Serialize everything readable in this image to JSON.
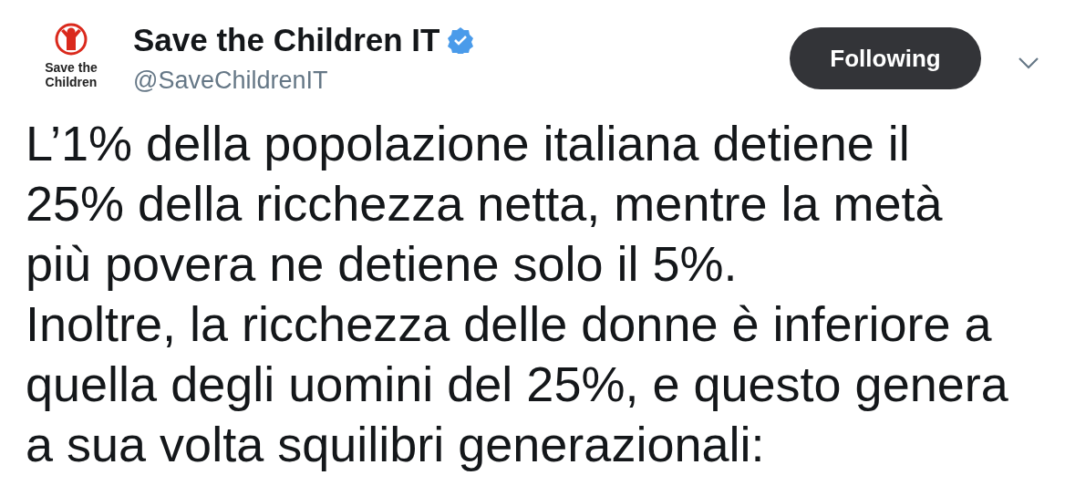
{
  "account": {
    "logo_lines": [
      "Save the",
      "Children"
    ],
    "name": "Save the Children IT",
    "verified": true,
    "handle": "@SaveChildrenIT"
  },
  "follow_button": {
    "label": "Following",
    "following": true
  },
  "tweet": {
    "lines": [
      "L’1% della popolazione italiana detiene il",
      "25% della ricchezza netta, mentre la metà",
      "più povera ne detiene solo il 5%.",
      "Inoltre, la ricchezza delle donne è inferiore a",
      "quella degli uomini del 25%, e questo genera",
      "a sua volta squilibri generazionali:"
    ]
  }
}
